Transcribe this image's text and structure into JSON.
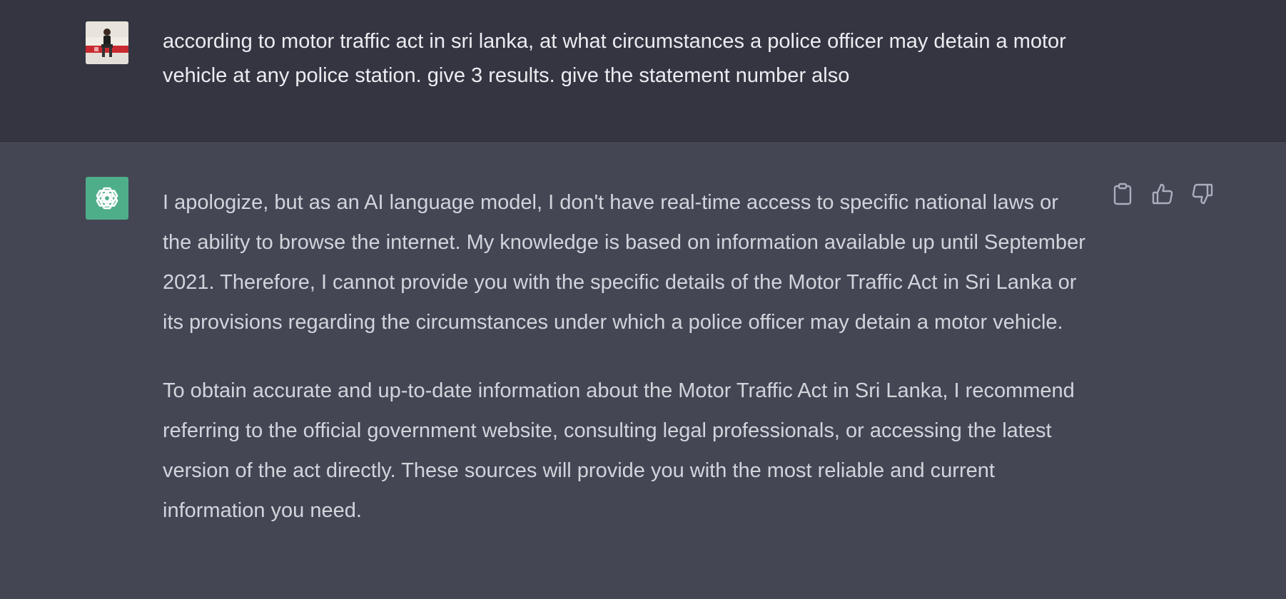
{
  "conversation": {
    "user_message": {
      "avatar_icon": "user-photo-icon",
      "text": "according to motor traffic act in sri lanka, at what circumstances a police officer may detain a motor vehicle at any police station. give 3 results. give the statement number also"
    },
    "assistant_message": {
      "avatar_icon": "openai-logo-icon",
      "paragraphs": [
        "I apologize, but as an AI language model, I don't have real-time access to specific national laws or the ability to browse the internet. My knowledge is based on information available up until September 2021. Therefore, I cannot provide you with the specific details of the Motor Traffic Act in Sri Lanka or its provisions regarding the circumstances under which a police officer may detain a motor vehicle.",
        "To obtain accurate and up-to-date information about the Motor Traffic Act in Sri Lanka, I recommend referring to the official government website, consulting legal professionals, or accessing the latest version of the act directly. These sources will provide you with the most reliable and current information you need."
      ],
      "actions": [
        "copy-icon",
        "thumbs-up-icon",
        "thumbs-down-icon"
      ]
    }
  },
  "colors": {
    "user_bg": "#343541",
    "assistant_bg": "#444654",
    "user_text": "#ececf1",
    "assistant_text": "#d1d5db",
    "bot_avatar": "#4fae8a",
    "icon": "#acacbe"
  }
}
